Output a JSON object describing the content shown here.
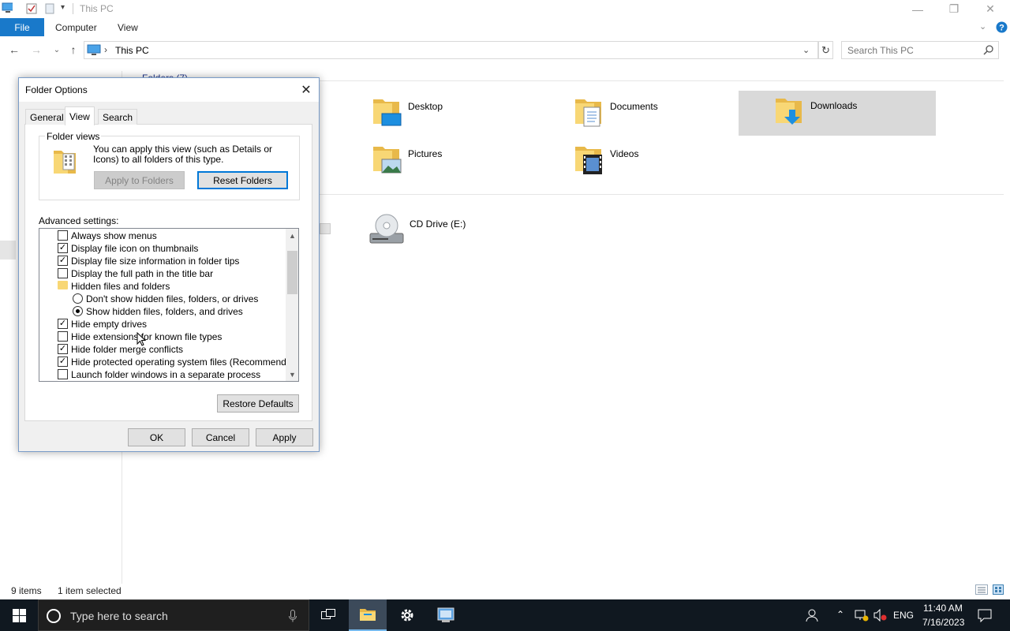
{
  "window": {
    "title": "This PC",
    "ribbon_tabs": [
      "File",
      "Computer",
      "View"
    ],
    "address_path": "This PC",
    "search_placeholder": "Search This PC"
  },
  "content": {
    "partial_header": "Folders (7)",
    "folders": [
      {
        "label": "Desktop",
        "icon": "desktop-folder-icon"
      },
      {
        "label": "Documents",
        "icon": "documents-folder-icon"
      },
      {
        "label": "Downloads",
        "icon": "downloads-folder-icon",
        "selected": true
      },
      {
        "label": "Pictures",
        "icon": "pictures-folder-icon"
      },
      {
        "label": "Videos",
        "icon": "videos-folder-icon"
      }
    ],
    "drives": [
      {
        "label": "CD Drive (E:)",
        "icon": "cd-drive-icon"
      }
    ]
  },
  "status": {
    "items": "9 items",
    "selected": "1 item selected"
  },
  "dialog": {
    "title": "Folder Options",
    "tabs": [
      "General",
      "View",
      "Search"
    ],
    "active_tab": "View",
    "folder_views": {
      "legend": "Folder views",
      "description": "You can apply this view (such as Details or Icons) to all folders of this type.",
      "apply_button": "Apply to Folders",
      "reset_button": "Reset Folders"
    },
    "advanced_label": "Advanced settings:",
    "advanced_items": [
      {
        "type": "checkbox",
        "label": "Always show menus",
        "checked": false
      },
      {
        "type": "checkbox",
        "label": "Display file icon on thumbnails",
        "checked": true
      },
      {
        "type": "checkbox",
        "label": "Display file size information in folder tips",
        "checked": true
      },
      {
        "type": "checkbox",
        "label": "Display the full path in the title bar",
        "checked": false
      },
      {
        "type": "folder",
        "label": "Hidden files and folders"
      },
      {
        "type": "radio",
        "label": "Don't show hidden files, folders, or drives",
        "checked": false
      },
      {
        "type": "radio",
        "label": "Show hidden files, folders, and drives",
        "checked": true
      },
      {
        "type": "checkbox",
        "label": "Hide empty drives",
        "checked": true
      },
      {
        "type": "checkbox",
        "label": "Hide extensions for known file types",
        "checked": false
      },
      {
        "type": "checkbox",
        "label": "Hide folder merge conflicts",
        "checked": true
      },
      {
        "type": "checkbox",
        "label": "Hide protected operating system files (Recommended)",
        "checked": true
      },
      {
        "type": "checkbox",
        "label": "Launch folder windows in a separate process",
        "checked": false
      }
    ],
    "restore_button": "Restore Defaults",
    "ok_button": "OK",
    "cancel_button": "Cancel",
    "apply_button": "Apply"
  },
  "taskbar": {
    "search_placeholder": "Type here to search",
    "language": "ENG",
    "time": "11:40 AM",
    "date": "7/16/2023"
  },
  "colors": {
    "accent": "#1979ca",
    "taskbar": "#101820",
    "selection": "#d9d9d9",
    "dialog_bg": "#f0f0f0"
  }
}
